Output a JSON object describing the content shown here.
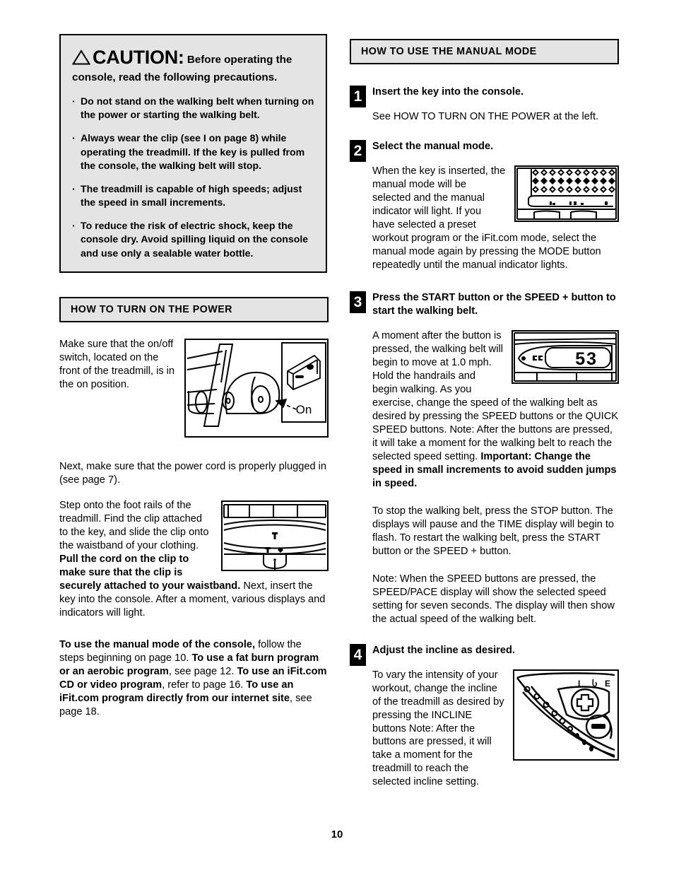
{
  "page": {
    "number": "10"
  },
  "caution": {
    "icon": "warning-triangle-icon",
    "word": "CAUTION",
    "colon": ":",
    "lead": "Before operating the console, read the following precautions.",
    "bullet_char": "·",
    "items": [
      "Do not stand on the walking belt when turning on the power or starting the walking belt.",
      "Always wear the clip (see I on page 8) while operating the treadmill. If the key is pulled from the console, the walking belt will stop.",
      "The treadmill is capable of high speeds; adjust the speed in small increments.",
      "To reduce the risk of electric shock, keep the console dry. Avoid spilling liquid on the console and use only a sealable water bottle."
    ],
    "bg_color": "#e4e4e4",
    "border_color": "#000000"
  },
  "power_section": {
    "heading": "HOW TO TURN ON THE POWER",
    "p1": "Make sure that the on/off switch, located on the front of the treadmill, is in the on position.",
    "figure_switch": {
      "name": "treadmill-power-switch-illustration",
      "callout_label": "On"
    },
    "p2": "Next, make sure that the power cord is properly plugged in (see page 7).",
    "p3_a": "Step onto the foot rails of the treadmill. Find the clip attached to the key, and slide the clip onto the waistband of your clothing. ",
    "p3_b": "Pull the cord on the clip to make sure that the clip is securely attached to your waistband.",
    "p3_c": " Next, insert the key into the console. After a moment, various displays and indicators will light.",
    "figure_clip": {
      "name": "clip-and-key-illustration"
    },
    "p4_1b": "To use the manual mode of the console,",
    "p4_1n": " follow the steps beginning on page 10. ",
    "p4_2b": "To use a fat burn program or an aerobic program",
    "p4_2n": ", see page 12. ",
    "p4_3b": "To use an iFit.com CD or video program",
    "p4_3n": ", refer to page 16. ",
    "p4_4b": "To use an iFit.com program directly from our internet site",
    "p4_4n": ", see page 18."
  },
  "manual_section": {
    "heading": "HOW TO USE THE MANUAL MODE",
    "steps": [
      {
        "number": "1",
        "title": "Insert the key into the console.",
        "body": "See HOW TO TURN ON THE POWER at the left."
      },
      {
        "number": "2",
        "title": "Select the manual mode.",
        "body": "When the key is inserted, the manual mode will be selected and the manual indicator will light. If you have selected a preset workout program or the iFit.com mode, select the manual mode again by pressing the MODE button repeatedly until the manual indicator lights.",
        "figure": {
          "name": "console-matrix-display-illustration"
        }
      },
      {
        "number": "3",
        "title": "Press the START button or the SPEED + button to start the walking belt.",
        "body_a": "A moment after the button is pressed, the walking belt will begin to move at 1.0 mph. Hold the handrails and begin walking. As you exercise, change the speed of the walking belt as desired by pressing the SPEED buttons or the QUICK SPEED buttons. Note: After the buttons are pressed, it will take a moment for the walking belt to reach the selected speed setting. ",
        "body_b": "Important: Change the speed in small increments to avoid sudden jumps in speed.",
        "body_c": "To stop the walking belt, press the STOP button. The displays will pause and the TIME display will begin to flash. To restart the walking belt, press the START button or the SPEED + button.",
        "body_d": "Note: When the SPEED buttons are pressed, the SPEED/PACE display will show the selected speed setting for seven seconds. The display will then show the actual speed of the walking belt.",
        "figure": {
          "name": "speed-display-illustration",
          "display_value": "53",
          "display_label": "cc"
        }
      },
      {
        "number": "4",
        "title": "Adjust the incline as desired.",
        "body": "To vary the intensity of your workout, change the incline of the treadmill as desired by pressing the INCLINE buttons Note: After the buttons are pressed, it will take a moment for the treadmill to reach the selected incline setting.",
        "figure": {
          "name": "incline-buttons-illustration",
          "labels": [
            "I",
            "LI",
            "E"
          ]
        }
      }
    ]
  }
}
